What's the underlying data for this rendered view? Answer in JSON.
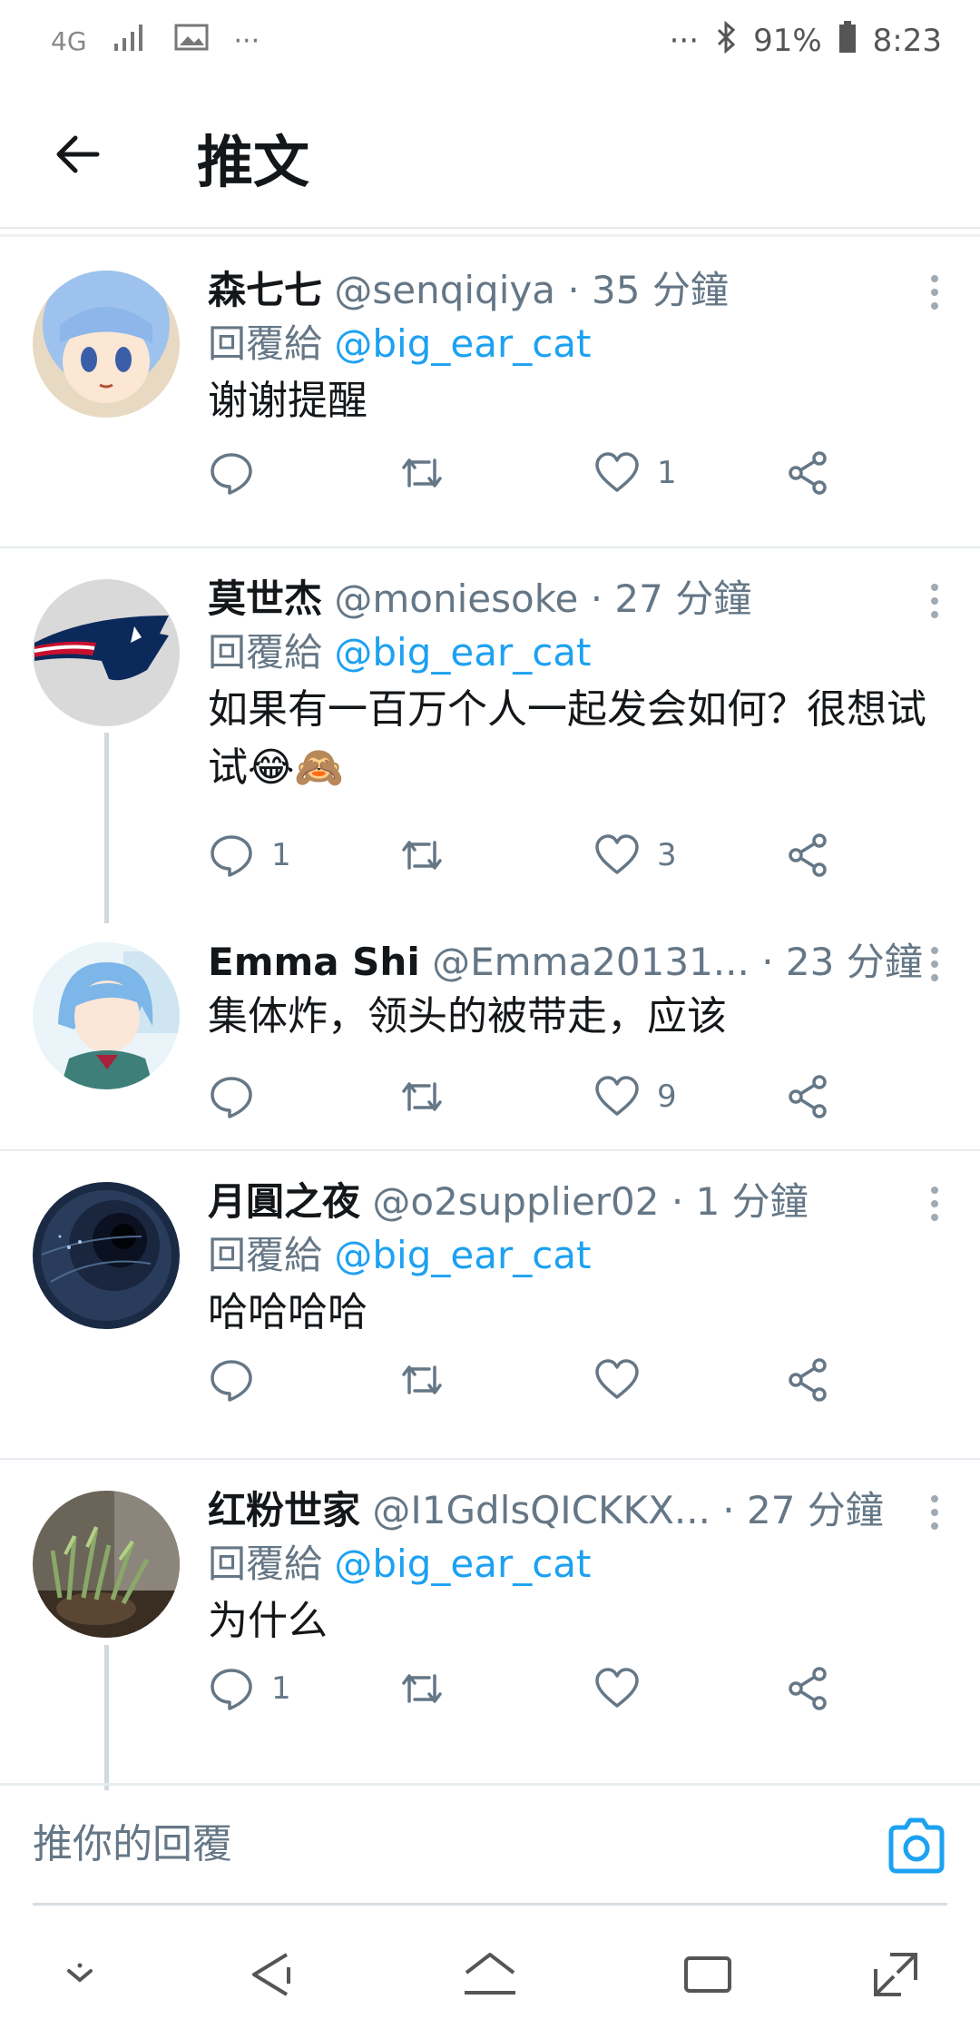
{
  "status_bar": {
    "network": "4G",
    "battery": "91%",
    "time": "8:23",
    "left_icons": [
      "signal-icon",
      "image-icon",
      "more-dots-icon"
    ],
    "right_icons": [
      "more-dots-icon",
      "bluetooth-icon",
      "battery-icon"
    ]
  },
  "header": {
    "title": "推文",
    "back_icon": "arrow-left-icon"
  },
  "tweets": [
    {
      "name": "森七七",
      "handle": "@senqiqiya",
      "time": "· 35 分鐘",
      "reply_prefix": "回覆給",
      "reply_to": "@big_ear_cat",
      "text": "谢谢提醒",
      "reply_count": "",
      "like_count": "1",
      "avatar_colors": [
        "#a9c8f0",
        "#e8d9c3"
      ]
    },
    {
      "name": "莫世杰",
      "handle": "@moniesoke",
      "time": "· 27 分鐘",
      "reply_prefix": "回覆給",
      "reply_to": "@big_ear_cat",
      "text": "如果有一百万个人一起发会如何？很想试试😂🙈",
      "reply_count": "1",
      "like_count": "3",
      "avatar_colors": [
        "#d9d9d9",
        "#0b2a5b",
        "#c8102e"
      ]
    },
    {
      "name": "Emma Shi",
      "handle": "@Emma20131...",
      "time": "· 23 分鐘",
      "reply_prefix": "",
      "reply_to": "",
      "text": "集体炸，领头的被带走，应该",
      "reply_count": "",
      "like_count": "9",
      "avatar_colors": [
        "#cfe6f2",
        "#7db6e8"
      ]
    },
    {
      "name": "月圓之夜",
      "handle": "@o2supplier02",
      "time": "· 1 分鐘",
      "reply_prefix": "回覆給",
      "reply_to": "@big_ear_cat",
      "text": "哈哈哈哈",
      "reply_count": "",
      "like_count": "",
      "avatar_colors": [
        "#1b2a44",
        "#4d6a8f"
      ]
    },
    {
      "name": "红粉世家",
      "handle": "@I1GdlsQICKKX...",
      "time": "· 27 分鐘",
      "reply_prefix": "回覆給",
      "reply_to": "@big_ear_cat",
      "text": "为什么",
      "reply_count": "1",
      "like_count": "",
      "avatar_colors": [
        "#3e4a2e",
        "#8aa86a"
      ]
    }
  ],
  "reply_bar": {
    "placeholder": "推你的回覆",
    "camera_icon": "camera-icon"
  },
  "nav_bar": {
    "icons": [
      "dropdown-icon",
      "back-triangle-icon",
      "home-icon",
      "recents-icon",
      "expand-icon"
    ]
  },
  "colors": {
    "accent": "#1da1f2",
    "muted": "#657786",
    "divider": "#e6ecf0"
  }
}
